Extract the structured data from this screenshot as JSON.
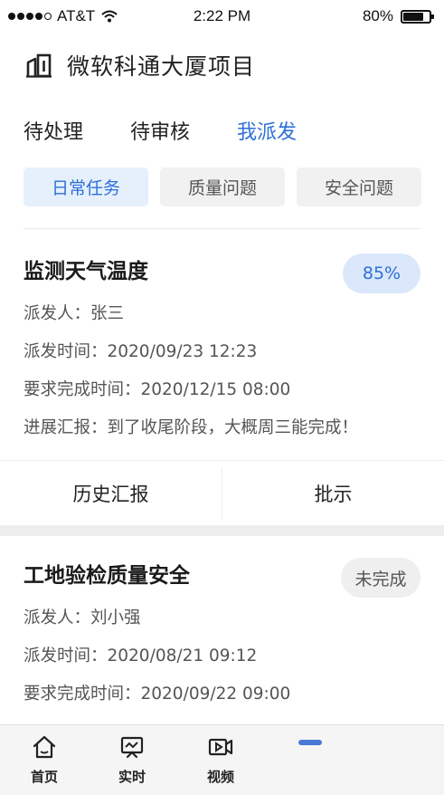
{
  "status_bar": {
    "carrier": "AT&T",
    "time": "2:22 PM",
    "battery": "80%",
    "battery_level": 0.8,
    "signal_bars": 4
  },
  "header": {
    "title": "微软科通大厦项目",
    "icon": "building-icon"
  },
  "main_tabs": [
    {
      "label": "待处理",
      "active": false
    },
    {
      "label": "待审核",
      "active": false
    },
    {
      "label": "我派发",
      "active": true
    }
  ],
  "category_tabs": [
    {
      "label": "日常任务",
      "active": true
    },
    {
      "label": "质量问题",
      "active": false
    },
    {
      "label": "安全问题",
      "active": false
    }
  ],
  "tasks": [
    {
      "title": "监测天气温度",
      "badge": "85%",
      "sender": "派发人：张三",
      "dispatch_time": "派发时间：2020/09/23 12:23",
      "due_time": "要求完成时间：2020/12/15 08:00",
      "progress_report": "进展汇报：到了收尾阶段，大概周三能完成！",
      "actions": [
        "历史汇报",
        "批示"
      ]
    },
    {
      "title": "工地验检质量安全",
      "badge": "未完成",
      "sender": "派发人：刘小强",
      "dispatch_time": "派发时间：2020/08/21 09:12",
      "due_time": "要求完成时间：2020/09/22 09:00"
    }
  ],
  "tab_bar": {
    "items": [
      {
        "label": "首页",
        "icon": "home-icon"
      },
      {
        "label": "实时",
        "icon": "monitor-icon"
      },
      {
        "label": "视频",
        "icon": "video-icon"
      }
    ]
  },
  "colors": {
    "accent": "#2e6fd8",
    "accent_light": "#e6f0fd",
    "badge_blue": "#dbe8fb",
    "neutral_tab": "#f1f1f1",
    "tabbar_bg": "#f5f5f5"
  }
}
